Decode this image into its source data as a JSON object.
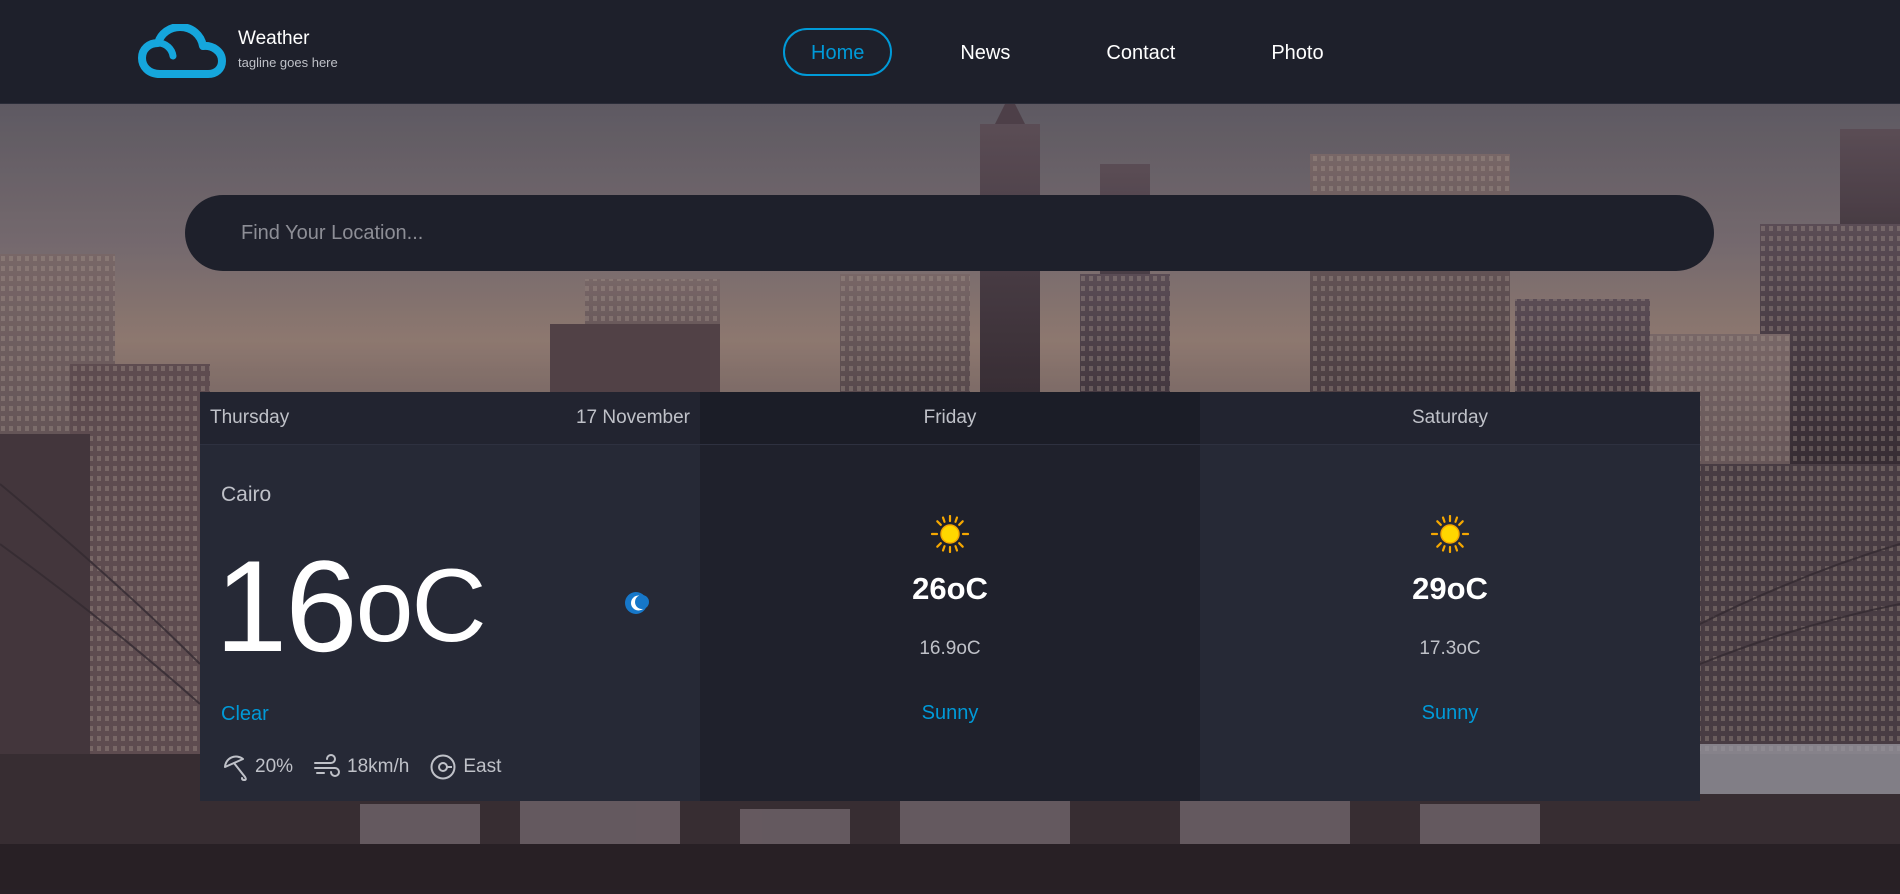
{
  "brand": {
    "title": "Weather",
    "tagline": "tagline goes here",
    "accent": "#009ad8"
  },
  "nav": {
    "items": [
      {
        "label": "Home",
        "active": true
      },
      {
        "label": "News",
        "active": false
      },
      {
        "label": "Contact",
        "active": false
      },
      {
        "label": "Photo",
        "active": false
      }
    ]
  },
  "search": {
    "placeholder": "Find Your Location...",
    "value": ""
  },
  "today": {
    "day": "Thursday",
    "date": "17 November",
    "city": "Cairo",
    "temp": "16",
    "unit": "oC",
    "icon": "moon-icon",
    "condition": "Clear",
    "rain": "20%",
    "wind_speed": "18km/h",
    "wind_direction": "East"
  },
  "forecast": [
    {
      "day": "Friday",
      "icon": "sun-icon",
      "max": "26oC",
      "min": "16.9oC",
      "condition": "Sunny"
    },
    {
      "day": "Saturday",
      "icon": "sun-icon",
      "max": "29oC",
      "min": "17.3oC",
      "condition": "Sunny"
    }
  ]
}
